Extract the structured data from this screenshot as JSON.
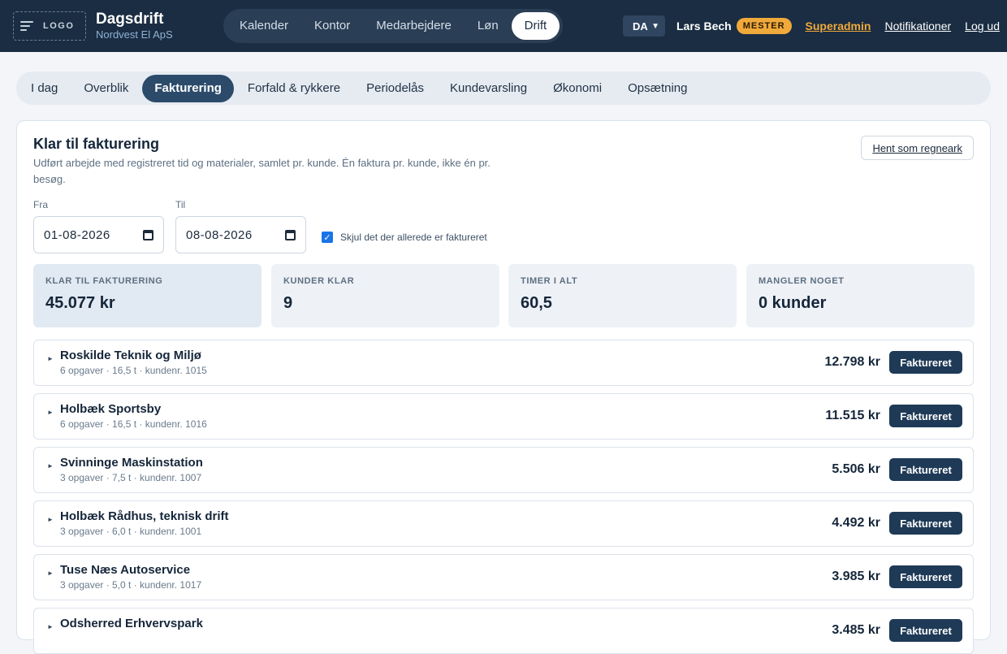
{
  "header": {
    "logo_text": "LOGO",
    "app_name": "Dagsdrift",
    "company": "Nordvest El ApS",
    "nav": [
      "Kalender",
      "Kontor",
      "Medarbejdere",
      "Løn",
      "Drift"
    ],
    "nav_active": "Drift",
    "language": "DA",
    "user_name": "Lars Bech",
    "role_badge": "MESTER",
    "links": {
      "superadmin": "Superadmin",
      "notifications": "Notifikationer",
      "logout": "Log ud"
    }
  },
  "subnav": {
    "items": [
      "I dag",
      "Overblik",
      "Fakturering",
      "Forfald & rykkere",
      "Periodelås",
      "Kundevarsling",
      "Økonomi",
      "Opsætning"
    ],
    "active": "Fakturering"
  },
  "panel": {
    "title": "Klar til fakturering",
    "description": "Udført arbejde med registreret tid og materialer, samlet pr. kunde. Én faktura pr. kunde, ikke én pr. besøg.",
    "export_label": "Hent som regneark",
    "from_label": "Fra",
    "from_value": "01-08-2026",
    "to_label": "Til",
    "to_value": "08-08-2026",
    "hide_invoiced_label": "Skjul det der allerede er faktureret",
    "hide_invoiced_checked": true
  },
  "stats": [
    {
      "label": "KLAR TIL FAKTURERING",
      "value": "45.077 kr"
    },
    {
      "label": "KUNDER KLAR",
      "value": "9"
    },
    {
      "label": "TIMER I ALT",
      "value": "60,5"
    },
    {
      "label": "MANGLER NOGET",
      "value": "0 kunder"
    }
  ],
  "customers": [
    {
      "name": "Roskilde Teknik og Miljø",
      "meta": "6 opgaver · 16,5 t · kundenr. 1015",
      "amount": "12.798 kr",
      "button": "Faktureret"
    },
    {
      "name": "Holbæk Sportsby",
      "meta": "6 opgaver · 16,5 t · kundenr. 1016",
      "amount": "11.515 kr",
      "button": "Faktureret"
    },
    {
      "name": "Svinninge Maskinstation",
      "meta": "3 opgaver · 7,5 t · kundenr. 1007",
      "amount": "5.506 kr",
      "button": "Faktureret"
    },
    {
      "name": "Holbæk Rådhus, teknisk drift",
      "meta": "3 opgaver · 6,0 t · kundenr. 1001",
      "amount": "4.492 kr",
      "button": "Faktureret"
    },
    {
      "name": "Tuse Næs Autoservice",
      "meta": "3 opgaver · 5,0 t · kundenr. 1017",
      "amount": "3.985 kr",
      "button": "Faktureret"
    },
    {
      "name": "Odsherred Erhvervspark",
      "meta": "",
      "amount": "3.485 kr",
      "button": "Faktureret"
    }
  ],
  "colors": {
    "header_bg": "#1a2d42",
    "accent": "#2c4b6b",
    "badge": "#f0a93b",
    "button": "#1e3a57"
  },
  "icons": {
    "menu": "menu-icon",
    "calendar": "calendar-icon",
    "chevron": "chevron-down-icon",
    "expand": "caret-right-icon",
    "check": "checkmark-icon"
  }
}
